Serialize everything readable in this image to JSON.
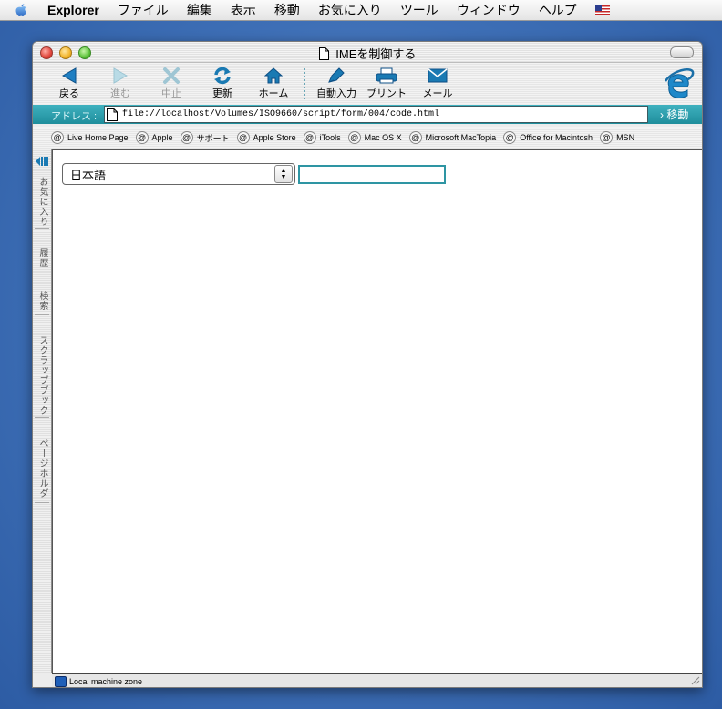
{
  "menubar": {
    "app_name": "Explorer",
    "items": [
      "ファイル",
      "編集",
      "表示",
      "移動",
      "お気に入り",
      "ツール",
      "ウィンドウ",
      "ヘルプ"
    ]
  },
  "window": {
    "title": "IMEを制御する"
  },
  "toolbar": {
    "buttons": [
      {
        "label": "戻る",
        "icon": "back-arrow-icon",
        "enabled": true
      },
      {
        "label": "進む",
        "icon": "forward-arrow-icon",
        "enabled": false
      },
      {
        "label": "中止",
        "icon": "stop-icon",
        "enabled": false
      },
      {
        "label": "更新",
        "icon": "refresh-icon",
        "enabled": true
      },
      {
        "label": "ホーム",
        "icon": "home-icon",
        "enabled": true
      },
      {
        "label": "自動入力",
        "icon": "autofill-icon",
        "enabled": true
      },
      {
        "label": "プリント",
        "icon": "print-icon",
        "enabled": true
      },
      {
        "label": "メール",
        "icon": "mail-icon",
        "enabled": true
      }
    ]
  },
  "address": {
    "label": "アドレス :",
    "url": "file://localhost/Volumes/ISO9660/script/form/004/code.html",
    "go_label": "› 移動"
  },
  "favorites": [
    "Live Home Page",
    "Apple",
    "サポート",
    "Apple Store",
    "iTools",
    "Mac OS X",
    "Microsoft MacTopia",
    "Office for Macintosh",
    "MSN"
  ],
  "sidebar": {
    "tabs": [
      "お気に入り",
      "履歴",
      "検索",
      "スクラップブック",
      "ページホルダ"
    ]
  },
  "page": {
    "select_value": "日本語",
    "text_value": ""
  },
  "status": {
    "zone": "Local machine zone"
  },
  "colors": {
    "accent": "#2e95a3",
    "address_bar": "#2a9eac",
    "desktop": "#3e6fb6"
  }
}
